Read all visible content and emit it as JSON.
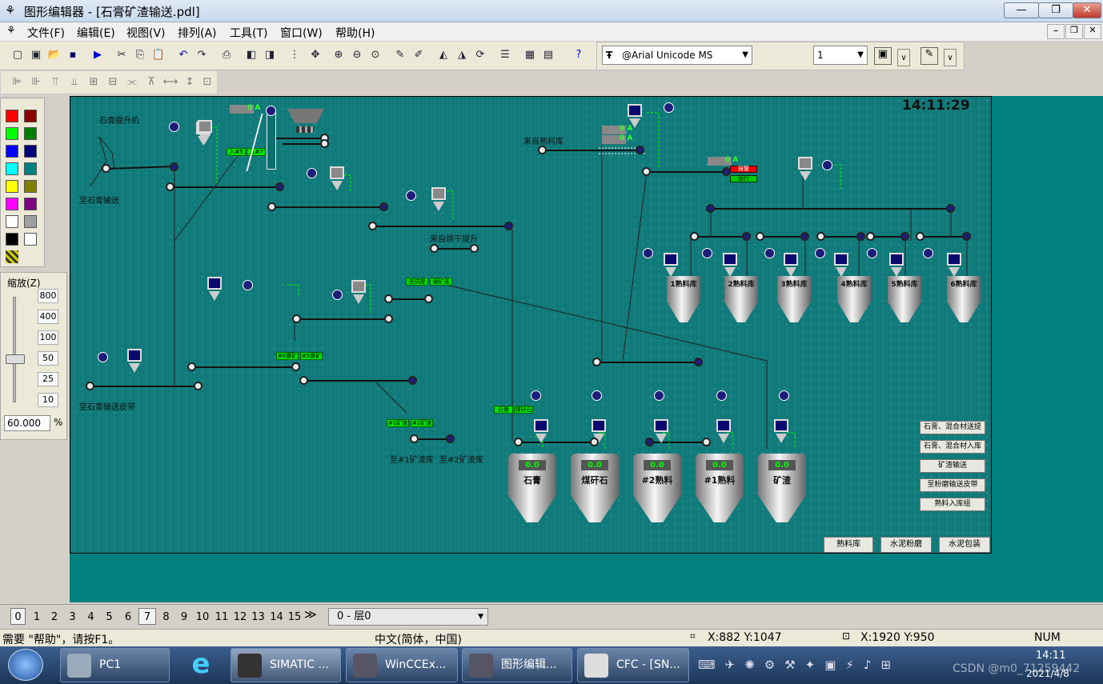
{
  "window": {
    "app_title": "图形编辑器 - [石膏矿渣输送.pdl]",
    "min": "—",
    "max": "❐",
    "close": "✕"
  },
  "menu": [
    "文件(F)",
    "编辑(E)",
    "视图(V)",
    "排列(A)",
    "工具(T)",
    "窗口(W)",
    "帮助(H)"
  ],
  "font_toolbar": {
    "font": "@Arial Unicode MS",
    "size": "1"
  },
  "palette_colors": [
    "#ff0000",
    "#8b0000",
    "#00ff00",
    "#008000",
    "#0000ff",
    "#000080",
    "#00ffff",
    "#008080",
    "#ffff00",
    "#808000",
    "#ff00ff",
    "#800080",
    "#ffffff",
    "#a0a0a0",
    "#000000",
    "#ffffff"
  ],
  "zoom": {
    "title": "缩放(Z)",
    "ticks": [
      "800",
      "400",
      "100",
      "50",
      "25",
      "10"
    ],
    "value": "60.000",
    "unit": "%"
  },
  "scene": {
    "clock": "14:11:29",
    "labels": {
      "gypsum_elevator": "石膏提升机",
      "to_gypsum_conveyor": "至石膏输送",
      "from_clinker_silo": "来自熟料库",
      "from_dry_elevator": "来自烘干提升",
      "to_gypsum_belt": "至石膏输送皮带",
      "to_slag_1": "至#1矿渣库",
      "to_slag_2": "至#2矿渣库",
      "amps": "0 A"
    },
    "green_tags": [
      "入#5库",
      "入#7库",
      "送烘提升",
      "缓矿送带",
      "#6膏矿",
      "#5膏矿",
      "石膏",
      "煤矸石",
      "#1矿渣库",
      "#2矿渣库"
    ],
    "status_tags": [
      "报警",
      "运行"
    ],
    "clinker_silos": [
      "1熟料库",
      "2熟料库",
      "3熟料库",
      "4熟料库",
      "5熟料库",
      "6熟料库"
    ],
    "bottom_silos": [
      {
        "name": "石膏",
        "value": "0.0"
      },
      {
        "name": "煤矸石",
        "value": "0.0"
      },
      {
        "name": "#2熟料",
        "value": "0.0"
      },
      {
        "name": "#1熟料",
        "value": "0.0"
      },
      {
        "name": "矿渣",
        "value": "0.0"
      }
    ],
    "right_buttons": [
      "石膏、混合材送提",
      "石膏、混合材入库",
      "矿渣输送",
      "至粉磨输送皮带",
      "熟料入库组"
    ],
    "bottom_buttons": [
      "熟料库",
      "水泥粉磨",
      "水泥包装"
    ]
  },
  "layers": {
    "tabs": [
      "0",
      "1",
      "2",
      "3",
      "4",
      "5",
      "6",
      "7",
      "8",
      "9",
      "10",
      "11",
      "12",
      "13",
      "14",
      "15"
    ],
    "current": "0 - 层0"
  },
  "status": {
    "help": "需要 \"帮助\"，请按F1。",
    "ime": "中文(简体，中国)",
    "pos": "X:882 Y:1047",
    "size": "X:1920 Y:950",
    "num": "NUM"
  },
  "taskbar": {
    "items": [
      "PC1",
      "SIMATIC ...",
      "WinCCEx...",
      "图形编辑...",
      "CFC - [SN..."
    ],
    "time": "14:11",
    "date": "2021/4/8",
    "watermark": "CSDN @m0_71259442"
  }
}
